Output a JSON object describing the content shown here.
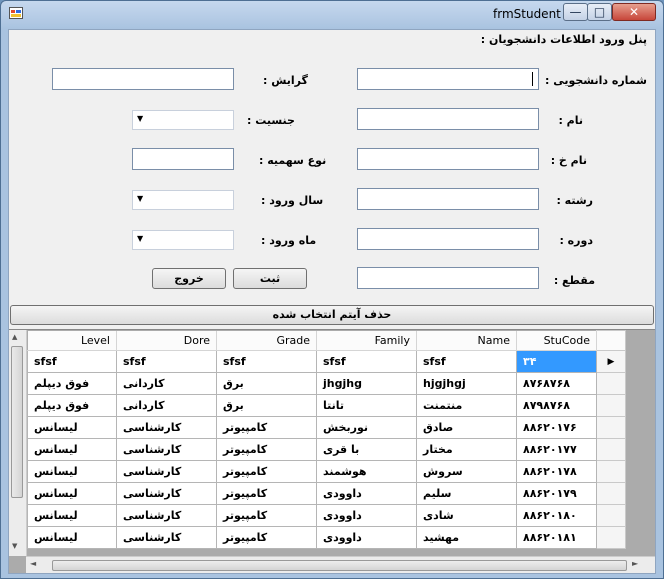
{
  "window": {
    "title": "frmStudent",
    "minimize": "—",
    "maximize": "□",
    "close": "✕"
  },
  "panel_title": "پنل ورود اطلاعات دانشجویان :",
  "labels": {
    "student_number": "شماره دانشجویی :",
    "major_track": "گرایش :",
    "first_name": "نام :",
    "gender": "جنسیت :",
    "last_name": "نام خ :",
    "quota_type": "نوع سهمیه :",
    "field": "رشته :",
    "entry_year": "سال ورود :",
    "course": "دوره :",
    "entry_month": "ماه ورود :",
    "level": "مقطع :"
  },
  "buttons": {
    "submit": "ثبت",
    "exit": "خروج",
    "delete_selected": "حذف آیتم انتخاب شده"
  },
  "grid": {
    "columns": [
      "StuCode",
      "Name",
      "Family",
      "Grade",
      "Dore",
      "Level"
    ],
    "current_row_marker": "▶",
    "rows": [
      [
        "۳۴",
        "sfsf",
        "sfsf",
        "sfsf",
        "sfsf",
        "sfsf"
      ],
      [
        "۸۷۶۸۷۶۸",
        "hjgjhgj",
        "jhgjhg",
        "برق",
        "کاردانی",
        "فوق دیپلم"
      ],
      [
        "۸۷۹۸۷۶۸",
        "منتمنت",
        "تانتا",
        "برق",
        "کاردانی",
        "فوق دیپلم"
      ],
      [
        "۸۸۶۲۰۱۷۶",
        "صادق",
        "نوربخش",
        "کامپیوتر",
        "کارشناسی",
        "لیسانس"
      ],
      [
        "۸۸۶۲۰۱۷۷",
        "مختار",
        "با قری",
        "کامپیوتر",
        "کارشناسی",
        "لیسانس"
      ],
      [
        "۸۸۶۲۰۱۷۸",
        "سروش",
        "هوشمند",
        "کامپیوتر",
        "کارشناسی",
        "لیسانس"
      ],
      [
        "۸۸۶۲۰۱۷۹",
        "سلیم",
        "داوودی",
        "کامپیوتر",
        "کارشناسی",
        "لیسانس"
      ],
      [
        "۸۸۶۲۰۱۸۰",
        "شادی",
        "داوودی",
        "کامپیوتر",
        "کارشناسی",
        "لیسانس"
      ],
      [
        "۸۸۶۲۰۱۸۱",
        "مهشید",
        "داوودی",
        "کامپیوتر",
        "کارشناسی",
        "لیسانس"
      ]
    ]
  },
  "colors": {
    "selection": "#3399ff",
    "titlebar": "#a9c3e0"
  }
}
